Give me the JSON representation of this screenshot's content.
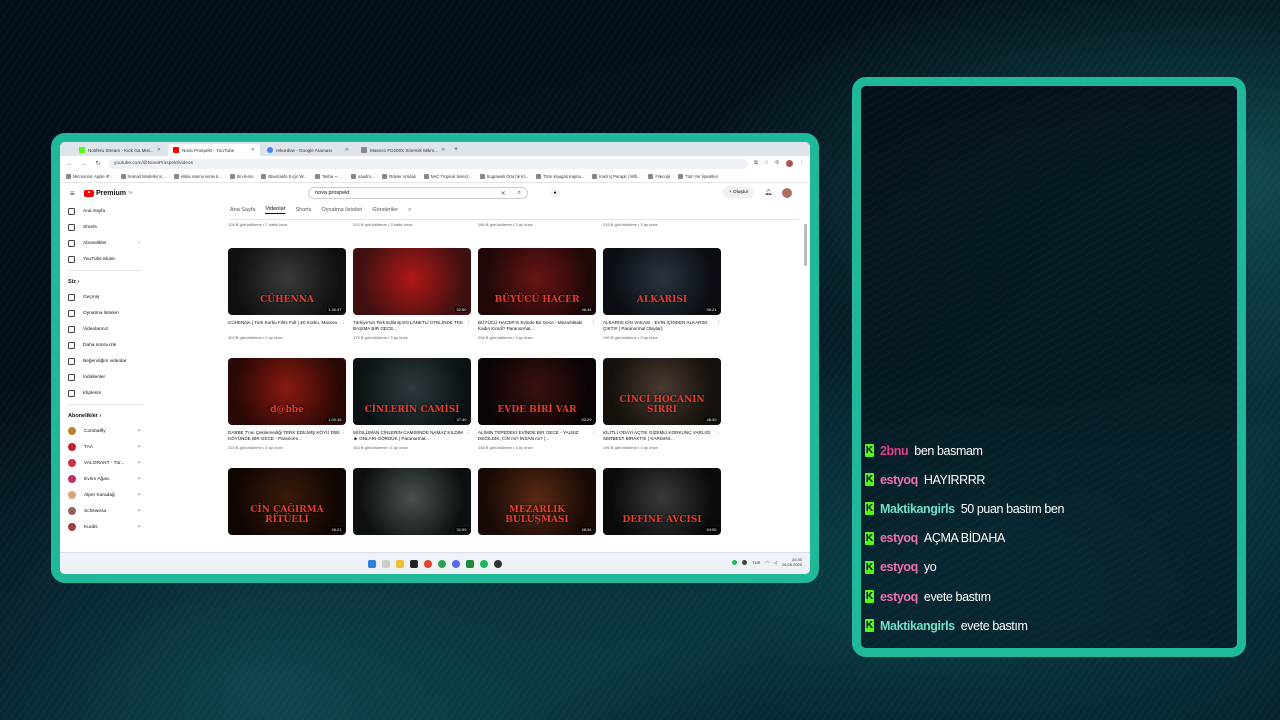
{
  "browser": {
    "tabs": [
      {
        "label": "Nosferu Stream - Kick Ga Misi...",
        "color": "#53fc18",
        "active": false
      },
      {
        "label": "Nova Prospekt - YouTube",
        "color": "#ff0000",
        "active": true
      },
      {
        "label": "rekordow - Google Araması",
        "color": "#4285f4",
        "active": false
      },
      {
        "label": "Masnco FD200X Sinemik Mikro...",
        "color": "#888888",
        "active": false
      }
    ],
    "url": "youtube.com/@NovaProspekt/videos",
    "bookmarks": [
      "Microsonic Apple iP...",
      "Nomad Modeller K...",
      "elitsa sosmu sensi ti...",
      "Sin-femo",
      "BlueSasfo 5 için W...",
      "Tasha — ...",
      "uaadm...",
      "Rdeler Arridali",
      "NAC Tropical Select...",
      "Sugraweli Orta hk Kl...",
      "Trize Kaugati Kajma...",
      "Kadi İç Parapit | Wifi...",
      "Filecopt",
      "Tüm Yer İşaretleri"
    ]
  },
  "youtube": {
    "logo_text": "Premium",
    "logo_sup": "TR",
    "search_value": "nova prospekt",
    "create_label": "Oluştur",
    "sidebar": {
      "main": [
        "Ana Sayfa",
        "Shorts",
        "Abonelikler",
        "YouTube Music"
      ],
      "you_title": "Siz",
      "you": [
        "Geçmiş",
        "Oynatma listeleri",
        "Videolarınız",
        "Daha sonra izle",
        "Beğendiğim videolar",
        "İndirilenler",
        "Kliplerim"
      ],
      "subs_title": "Abonelikler",
      "subs": [
        {
          "name": "Combatfly",
          "color": "#c08030"
        },
        {
          "name": "TAA",
          "color": "#c02030"
        },
        {
          "name": "VALORANT - Tür...",
          "color": "#d03040"
        },
        {
          "name": "Evrim Ağacı",
          "color": "#c03060"
        },
        {
          "name": "Alper Karadağ",
          "color": "#e0a080"
        },
        {
          "name": "Schewesa",
          "color": "#9a6060"
        },
        {
          "name": "Kurdis",
          "color": "#a04040"
        }
      ]
    },
    "channel_tabs": [
      "Ana Sayfa",
      "Videolar",
      "Shorts",
      "Oynatma listeleri",
      "Gönderiler"
    ],
    "prev_row_meta": [
      "128 B görüntüleme • 2 hafta önce",
      "202 B görüntüleme • 3 hafta önce",
      "186 B görüntüleme • 3 ay önce",
      "216 B görüntüleme • 3 ay önce"
    ],
    "videos": [
      [
        {
          "thumb_text": "CÜHENNA",
          "duration": "1:30:37",
          "title": "CÜHENNA | Türk Korku Filmi Full | 4K Korku, Macera",
          "meta": "303 B görüntüleme • 2 ay önce",
          "colors": [
            "#3a3a3a",
            "#101010"
          ]
        },
        {
          "thumb_text": "",
          "duration": "52:50",
          "title": "Türkiye'nin Terk Edilmiş EN LANETLİ OTELİNDE TEK BAŞIMA BİR GECE...",
          "meta": "175 B görüntüleme • 3 ay önce",
          "colors": [
            "#b01818",
            "#401010"
          ]
        },
        {
          "thumb_text": "BÜYÜCÜ HACER",
          "duration": "46:44",
          "title": "BÜYÜCÜ HACER'in Evinde Bir Gece - Mezarlıktaki Kadın Kimdi? Paranormal...",
          "meta": "206 B görüntüleme • 3 ay önce",
          "colors": [
            "#6a1414",
            "#200808"
          ]
        },
        {
          "thumb_text": "ALKARISI",
          "duration": "56:21",
          "title": "ALKARISI CİN VAKASI - EVİN İÇİNDEN ALKARISI ÇIKTI!! ( Paranormal Olaylar)",
          "meta": "190 B görüntüleme • 3 ay önce",
          "colors": [
            "#2a3440",
            "#0a0d12"
          ]
        }
      ],
      [
        {
          "thumb_text": "d@bbe",
          "duration": "1:00:16",
          "title": "DABBE 7'nin Çekilemediği TERK EDİLMİŞ KÖYÜ DİBİ KÖYÜNDE BİR GECE - Paranorm...",
          "meta": "223 B görüntüleme • 4 ay önce",
          "colors": [
            "#8a1a10",
            "#2a0806"
          ]
        },
        {
          "thumb_text": "CİNLERİN CAMİSİ",
          "duration": "47:40",
          "title": "MÜSLÜMAN CİNLERİN CAMİSİNDE NAMAZ KILDIM ☻ ONLARI GÖRDÜK | Paranormal...",
          "meta": "163 B görüntüleme • 4 ay önce",
          "colors": [
            "#2e3a3e",
            "#0c1214"
          ]
        },
        {
          "thumb_text": "EVDE BİRİ VAR",
          "duration": "53:29",
          "title": "ALİMİN TEPEDEKİ EVİNDE BİR GECE - YALNIZ DEĞİLDİK, CİN mi? İNSAN mı? |...",
          "meta": "148 B görüntüleme • 4 ay önce",
          "colors": [
            "#3a1010",
            "#0a0404"
          ]
        },
        {
          "thumb_text": "CİNCİ HOCANIN SIRRI",
          "duration": "48:30",
          "title": "KİLİTLİ ODAYI AÇTIK GİZEMLİ KORKUNÇ VARLIĞI SERBEST BIRAKTIK | KARISINI...",
          "meta": "196 B görüntüleme • 4 ay önce",
          "colors": [
            "#4a3a30",
            "#14100c"
          ]
        }
      ],
      [
        {
          "thumb_text": "CİN ÇAĞIRMA RİTÜELİ",
          "duration": "45:21",
          "title": "",
          "meta": "",
          "colors": [
            "#3a1a0a",
            "#100604"
          ]
        },
        {
          "thumb_text": "",
          "duration": "31:09",
          "title": "",
          "meta": "",
          "colors": [
            "#4a5050",
            "#0c1010"
          ]
        },
        {
          "thumb_text": "MEZARLIK BULUŞMASI",
          "duration": "48:34",
          "title": "",
          "meta": "",
          "colors": [
            "#5a2a14",
            "#180a06"
          ]
        },
        {
          "thumb_text": "DEFİNE AVCISI",
          "duration": "54:05",
          "title": "",
          "meta": "",
          "colors": [
            "#3a3a3a",
            "#0a0a0a"
          ]
        }
      ]
    ]
  },
  "taskbar": {
    "lang": "TUR",
    "time": "20:30",
    "date": "26.06.2025"
  },
  "chat": {
    "badge": "K",
    "messages": [
      {
        "user": "2bnu",
        "user_color": "#e0408a",
        "text": "ben basmam"
      },
      {
        "user": "estyoq",
        "user_color": "#f070b0",
        "text": "HAYIRRRR"
      },
      {
        "user": "Maktikangirls",
        "user_color": "#6fe0c8",
        "text": "50 puan bastım ben"
      },
      {
        "user": "estyoq",
        "user_color": "#f070b0",
        "text": "AÇMA BİDAHA"
      },
      {
        "user": "estyoq",
        "user_color": "#f070b0",
        "text": "yo"
      },
      {
        "user": "estyoq",
        "user_color": "#f070b0",
        "text": "evete bastım"
      },
      {
        "user": "Maktikangirls",
        "user_color": "#6fe0c8",
        "text": "evete bastım"
      }
    ]
  }
}
